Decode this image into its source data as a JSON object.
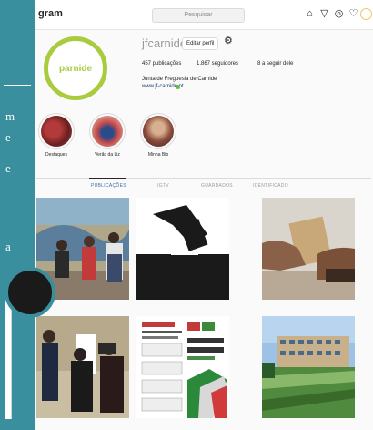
{
  "slide": {
    "text_fragments": [
      "m",
      "e",
      "e",
      "a"
    ],
    "colors": {
      "teal": "#3a8f9e"
    }
  },
  "topbar": {
    "logo": "gram",
    "search_placeholder": "Pesquisar",
    "icons": [
      "home-icon",
      "direct-icon",
      "explore-icon",
      "heart-icon",
      "profile-icon"
    ]
  },
  "profile": {
    "avatar_text": "parnide",
    "username": "jfcarnide",
    "edit_label": "Editar perfil",
    "stats": [
      "457 publicações",
      "1.867 seguidores",
      "8 a seguir dele"
    ],
    "bio_name": "Junta de Freguesia de Carnide",
    "bio_link": "www.jf-carnide.pt",
    "accent_color": "#a9cc3f"
  },
  "highlights": [
    {
      "label": "Destaques"
    },
    {
      "label": "Verão da Liz"
    },
    {
      "label": "Minha Bib"
    }
  ],
  "tabs": [
    {
      "label": "PUBLICAÇÕES",
      "active": true
    },
    {
      "label": "IGTV",
      "active": false
    },
    {
      "label": "GUARDADOS",
      "active": false
    },
    {
      "label": "IDENTIFICADO",
      "active": false
    }
  ],
  "posts": [
    {
      "name": "post-mural-group"
    },
    {
      "name": "post-ballot-box"
    },
    {
      "name": "post-ballot-hand"
    },
    {
      "name": "post-interview"
    },
    {
      "name": "post-election-flyer"
    },
    {
      "name": "post-building-garden"
    }
  ]
}
